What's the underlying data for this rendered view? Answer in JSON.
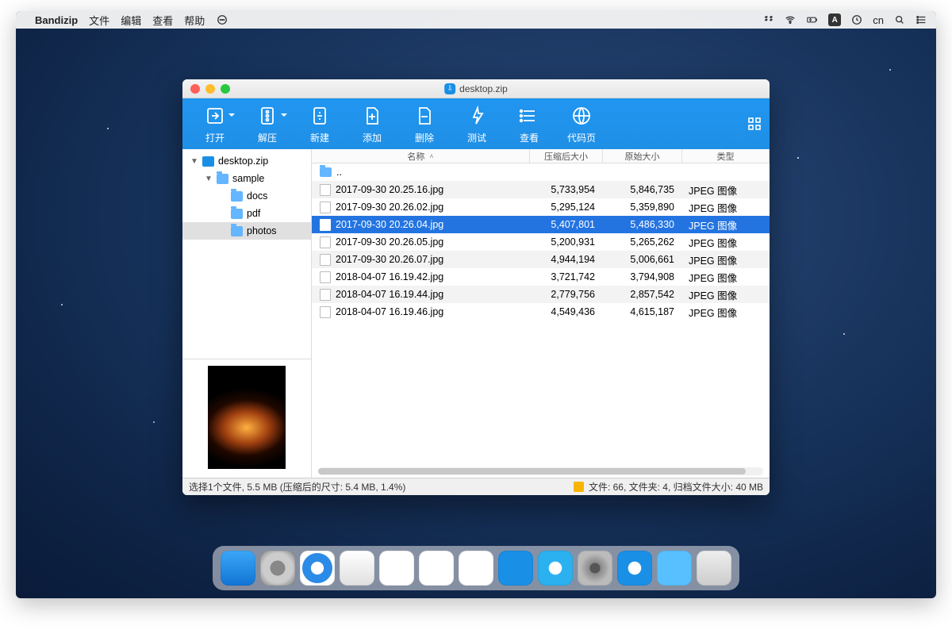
{
  "menubar": {
    "app": "Bandizip",
    "items": [
      "文件",
      "编辑",
      "查看",
      "帮助"
    ],
    "input_lang": "cn"
  },
  "window": {
    "title": "desktop.zip",
    "toolbar": {
      "open": "打开",
      "extract": "解压",
      "new": "新建",
      "add": "添加",
      "delete": "删除",
      "test": "测试",
      "view": "查看",
      "codepage": "代码页"
    },
    "tree": {
      "root": "desktop.zip",
      "sample": "sample",
      "docs": "docs",
      "pdf": "pdf",
      "photos": "photos"
    },
    "columns": {
      "name": "名称",
      "compressed": "压缩后大小",
      "original": "原始大小",
      "type": "类型"
    },
    "updir": "..",
    "files": [
      {
        "name": "2017-09-30 20.25.16.jpg",
        "csize": "5,733,954",
        "osize": "5,846,735",
        "type": "JPEG 图像",
        "sel": false
      },
      {
        "name": "2017-09-30 20.26.02.jpg",
        "csize": "5,295,124",
        "osize": "5,359,890",
        "type": "JPEG 图像",
        "sel": false
      },
      {
        "name": "2017-09-30 20.26.04.jpg",
        "csize": "5,407,801",
        "osize": "5,486,330",
        "type": "JPEG 图像",
        "sel": true
      },
      {
        "name": "2017-09-30 20.26.05.jpg",
        "csize": "5,200,931",
        "osize": "5,265,262",
        "type": "JPEG 图像",
        "sel": false
      },
      {
        "name": "2017-09-30 20.26.07.jpg",
        "csize": "4,944,194",
        "osize": "5,006,661",
        "type": "JPEG 图像",
        "sel": false
      },
      {
        "name": "2018-04-07 16.19.42.jpg",
        "csize": "3,721,742",
        "osize": "3,794,908",
        "type": "JPEG 图像",
        "sel": false
      },
      {
        "name": "2018-04-07 16.19.44.jpg",
        "csize": "2,779,756",
        "osize": "2,857,542",
        "type": "JPEG 图像",
        "sel": false
      },
      {
        "name": "2018-04-07 16.19.46.jpg",
        "csize": "4,549,436",
        "osize": "4,615,187",
        "type": "JPEG 图像",
        "sel": false
      }
    ],
    "status_left": "选择1个文件, 5.5 MB (压缩后的尺寸: 5.4 MB, 1.4%)",
    "status_right": "文件: 66, 文件夹: 4, 归档文件大小: 40 MB"
  },
  "dock": [
    {
      "name": "finder",
      "bg": "linear-gradient(#3aa7f8,#1274d4)"
    },
    {
      "name": "launchpad",
      "bg": "radial-gradient(circle,#888 30%,#ccc 31%,#ccc 60%,#777 100%)"
    },
    {
      "name": "safari",
      "bg": "radial-gradient(circle,#fff 25%,#2b8be6 27%,#2b8be6 60%,#fff 62%)"
    },
    {
      "name": "mail",
      "bg": "linear-gradient(#fff,#e0e0e0)"
    },
    {
      "name": "reminders",
      "bg": "#fff"
    },
    {
      "name": "photos",
      "bg": "#fff"
    },
    {
      "name": "numbers",
      "bg": "#fff"
    },
    {
      "name": "keynote",
      "bg": "#1a8fe6"
    },
    {
      "name": "appstore",
      "bg": "radial-gradient(circle,#fff 25%,#2bb0f0 28%)"
    },
    {
      "name": "preferences",
      "bg": "radial-gradient(circle,#555 20%,#888 22%,#bbb 60%)"
    },
    {
      "name": "bandizip",
      "bg": "radial-gradient(circle,#fff 25%,#1a8fe6 28%)"
    },
    {
      "name": "downloads",
      "bg": "#58c0ff"
    },
    {
      "name": "trash",
      "bg": "linear-gradient(#eee,#ccc)"
    }
  ]
}
